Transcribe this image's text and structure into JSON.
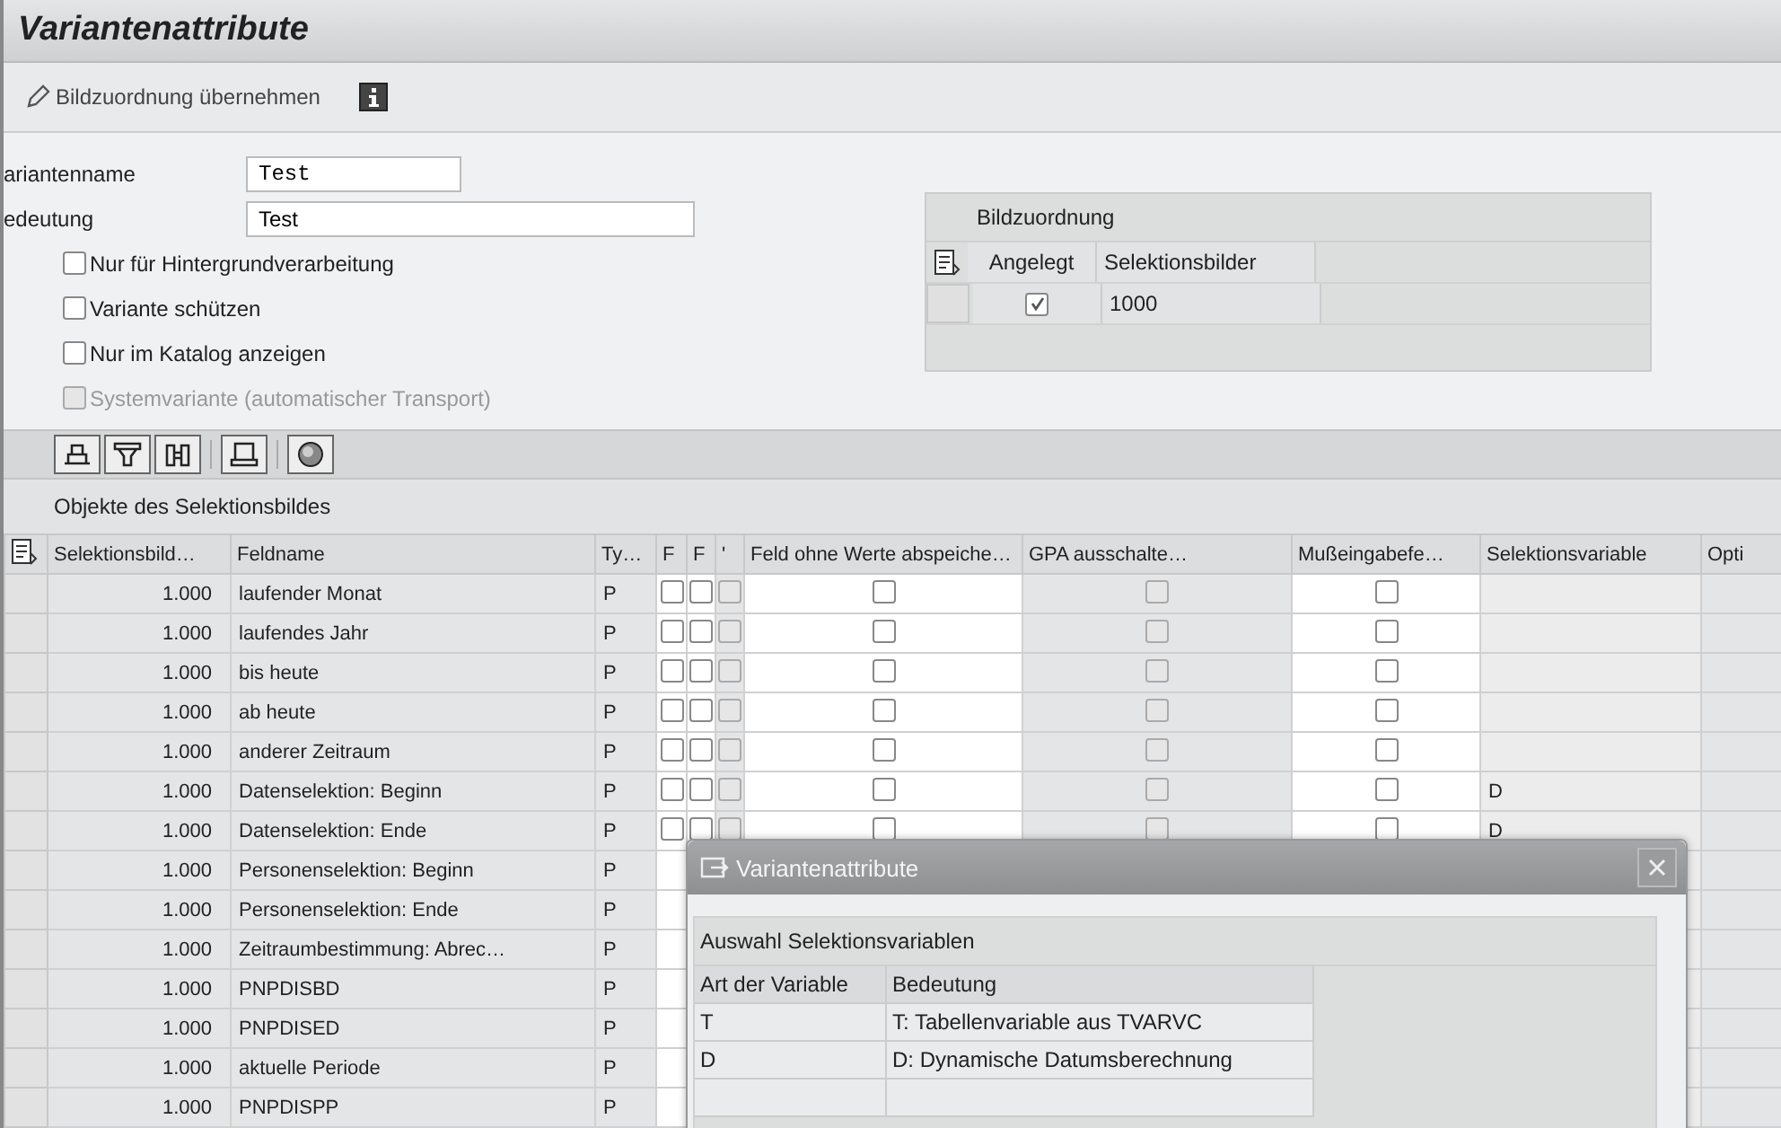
{
  "window": {
    "title": "Variantenattribute"
  },
  "toolbar": {
    "action": "Bildzuordnung übernehmen"
  },
  "form": {
    "fields": [
      {
        "label": "ariantenname",
        "value": "Test",
        "kind": "mono"
      },
      {
        "label": "edeutung",
        "value": "Test",
        "kind": "wide"
      }
    ],
    "options": [
      {
        "label": "Nur für Hintergrundverarbeitung",
        "checked": false,
        "disabled": false
      },
      {
        "label": "Variante schützen",
        "checked": false,
        "disabled": false
      },
      {
        "label": "Nur im Katalog anzeigen",
        "checked": false,
        "disabled": false
      },
      {
        "label": "Systemvariante (automatischer Transport)",
        "checked": false,
        "disabled": true
      }
    ]
  },
  "assignment": {
    "title": "Bildzuordnung",
    "columns": [
      "Angelegt",
      "Selektionsbilder"
    ],
    "rows": [
      {
        "created": true,
        "screen": "1000"
      }
    ]
  },
  "grid": {
    "title": "Objekte des Selektionsbildes",
    "columns": [
      {
        "label": "Selektionsbild…",
        "kind": "number"
      },
      {
        "label": "Feldname",
        "kind": "text"
      },
      {
        "label": "Ty…",
        "kind": "text"
      },
      {
        "label": "F",
        "kind": "check",
        "disabled": false
      },
      {
        "label": "F",
        "kind": "check",
        "disabled": false
      },
      {
        "label": "'",
        "kind": "check",
        "disabled": true
      },
      {
        "label": "Feld ohne Werte abspeiche…",
        "kind": "check",
        "disabled": false
      },
      {
        "label": "GPA ausschalte…",
        "kind": "check",
        "disabled": true
      },
      {
        "label": "Mußeingabefe…",
        "kind": "check",
        "disabled": false
      },
      {
        "label": "Selektionsvariable",
        "kind": "text"
      },
      {
        "label": "Opti",
        "kind": "text"
      }
    ],
    "rows": [
      {
        "cells": [
          "1.000",
          "laufender Monat",
          "P",
          false,
          false,
          false,
          false,
          false,
          false
        ]
      },
      {
        "cells": [
          "1.000",
          "laufendes Jahr",
          "P",
          false,
          false,
          false,
          false,
          false,
          false
        ]
      },
      {
        "cells": [
          "1.000",
          "bis heute",
          "P",
          false,
          false,
          false,
          false,
          false,
          false
        ]
      },
      {
        "cells": [
          "1.000",
          "ab heute",
          "P",
          false,
          false,
          false,
          false,
          false,
          false
        ]
      },
      {
        "cells": [
          "1.000",
          "anderer Zeitraum",
          "P",
          false,
          false,
          false,
          false,
          false,
          false
        ]
      },
      {
        "cells": [
          "1.000",
          "Datenselektion: Beginn",
          "P",
          false,
          false,
          false,
          false,
          false,
          false,
          "D"
        ]
      },
      {
        "cells": [
          "1.000",
          "Datenselektion: Ende",
          "P",
          false,
          false,
          false,
          false,
          false,
          false,
          "D"
        ]
      },
      {
        "cells": [
          "1.000",
          "Personenselektion: Beginn",
          "P"
        ]
      },
      {
        "cells": [
          "1.000",
          "Personenselektion: Ende",
          "P"
        ]
      },
      {
        "cells": [
          "1.000",
          "Zeitraumbestimmung: Abrec…",
          "P"
        ]
      },
      {
        "cells": [
          "1.000",
          "PNPDISBD",
          "P"
        ]
      },
      {
        "cells": [
          "1.000",
          "PNPDISED",
          "P"
        ]
      },
      {
        "cells": [
          "1.000",
          "aktuelle Periode",
          "P"
        ]
      },
      {
        "cells": [
          "1.000",
          "PNPDISPP",
          "P"
        ]
      }
    ]
  },
  "dialog": {
    "title": "Variantenattribute",
    "group": "Auswahl Selektionsvariablen",
    "columns": [
      "Art der Variable",
      "Bedeutung"
    ],
    "rows": [
      [
        "T",
        "T: Tabellenvariable aus TVARVC"
      ],
      [
        "D",
        "D: Dynamische Datumsberechnung"
      ]
    ]
  }
}
